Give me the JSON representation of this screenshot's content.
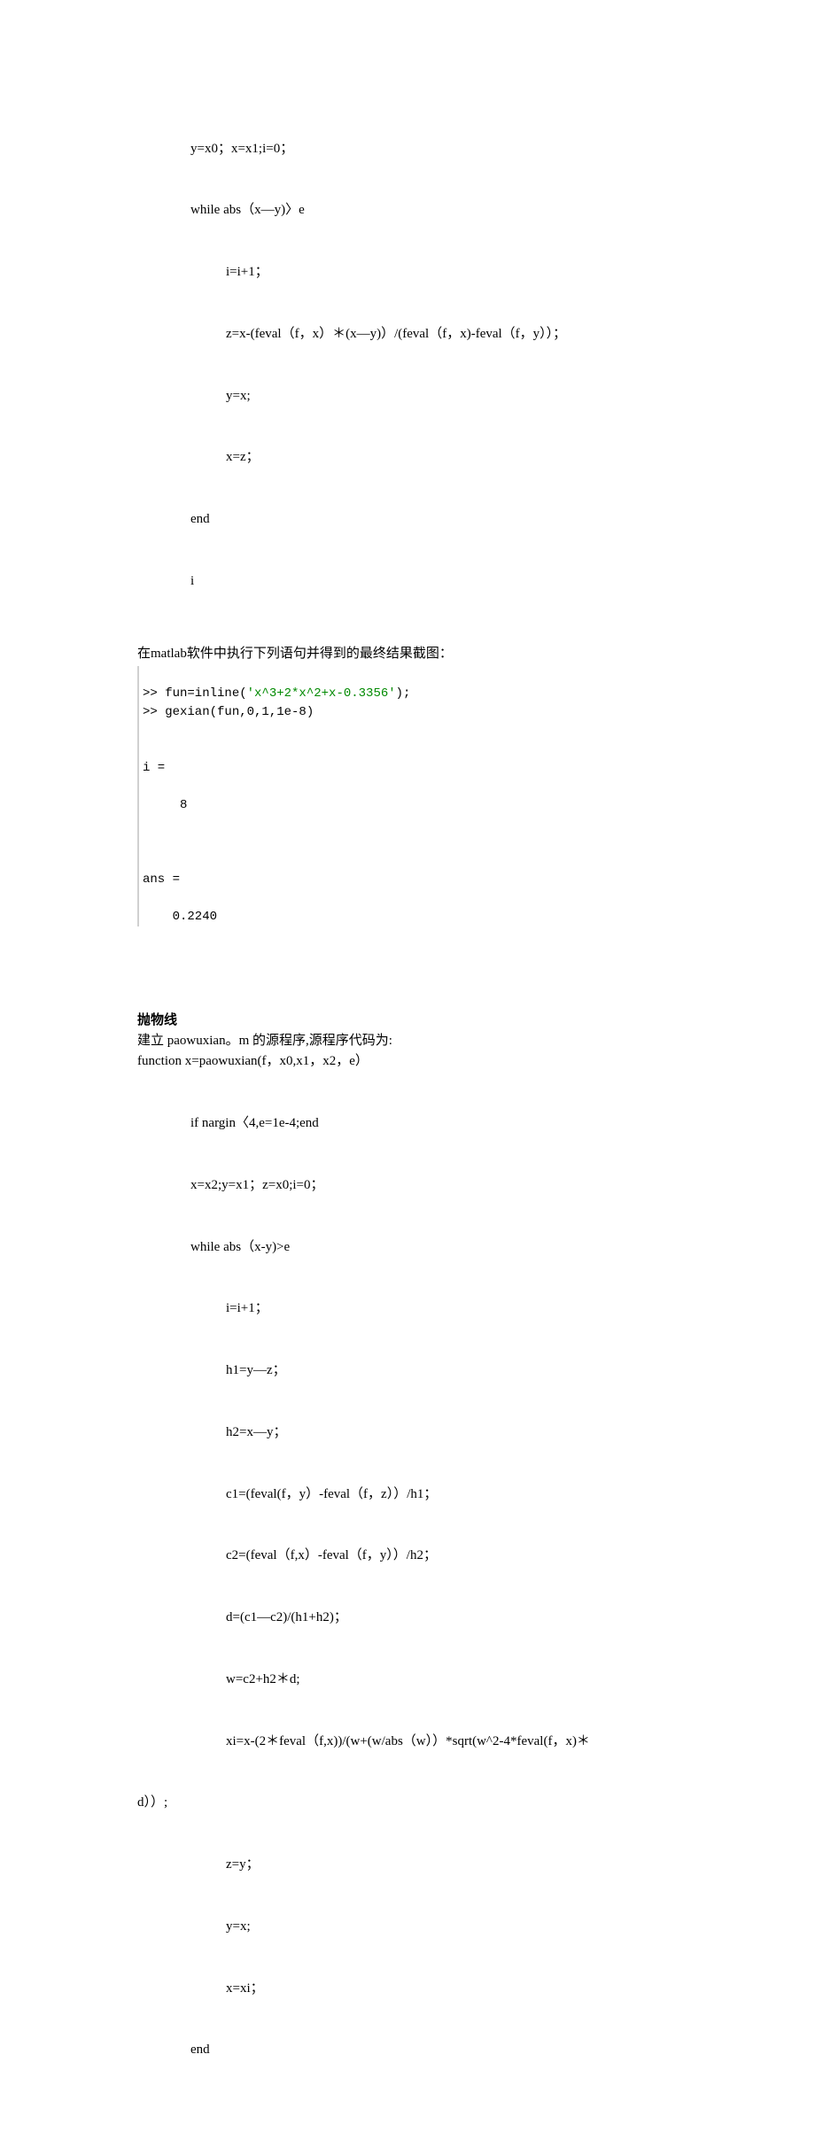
{
  "gexian": {
    "l1": "y=x0；x=x1;i=0；",
    "l2": "while abs（x—y)〉e",
    "l3": "i=i+1；",
    "l4": "z=x-(feval（f，x）＊(x—y)）/(feval（f，x)-feval（f，y））；",
    "l5": "y=x;",
    "l6": "x=z；",
    "l7": "end",
    "l8": "i"
  },
  "cn1": "在matlab软件中执行下列语句并得到的最终结果截图：",
  "console": {
    "l1a": ">> fun=inline(",
    "l1b": "'x^3+2*x^2+x-0.3356'",
    "l1c": ");",
    "l2": ">> gexian(fun,0,1,1e-8)",
    "l3": "",
    "l4": "",
    "l5": "i =",
    "l6": "",
    "l7": "     8",
    "l8": "",
    "l9": "",
    "l10": "",
    "l11": "ans =",
    "l12": "",
    "l13": "    0.2240"
  },
  "section2_title": "抛物线",
  "section2_desc": "建立 paowuxian。m 的源程序,源程序代码为:",
  "paowuxian": {
    "l1": "function x=paowuxian(f，x0,x1，x2，e）",
    "l2": "if nargin〈4,e=1e-4;end",
    "l3": "x=x2;y=x1；z=x0;i=0；",
    "l4": "while abs（x-y)>e",
    "l5": "i=i+1；",
    "l6": "h1=y—z；",
    "l7": "h2=x—y；",
    "l8": "c1=(feval(f，y）-feval（f，z））/h1；",
    "l9": "c2=(feval（f,x）-feval（f，y））/h2；",
    "l10": "d=(c1—c2)/(h1+h2)；",
    "l11": "w=c2+h2＊d;",
    "l12a": "xi=x-(2＊feval（f,x))/(w+(w/abs（w））*sqrt(w^2-4*feval(f，x)＊",
    "l12b": "d））;",
    "l13": "z=y；",
    "l14": "y=x;",
    "l15": "x=xi；",
    "l16": "end"
  }
}
